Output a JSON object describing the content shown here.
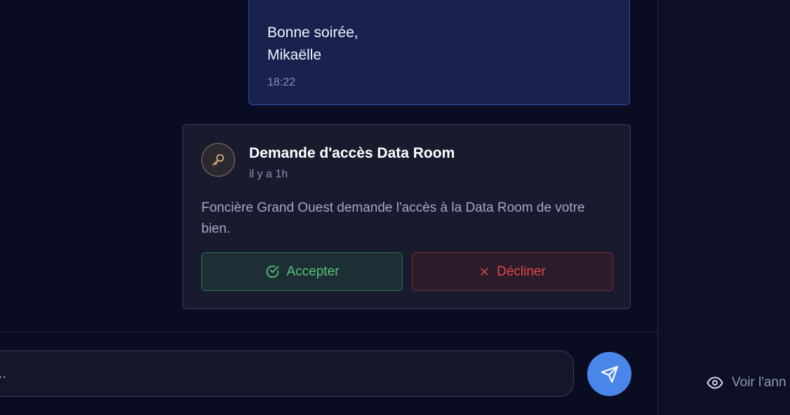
{
  "message": {
    "lines": [
      "Bonne soirée,",
      "Mikaëlle"
    ],
    "time": "18:22"
  },
  "request_card": {
    "icon": "key-icon",
    "title": "Demande d'accès Data Room",
    "time_ago": "il y a 1h",
    "body": "Foncière Grand Ouest demande l'accès à la Data Room de votre bien.",
    "accept_label": "Accepter",
    "decline_label": "Décliner"
  },
  "composer": {
    "placeholder": "e...",
    "send_icon": "send-icon"
  },
  "side_panel": {
    "view_link_label": "Voir l'ann",
    "view_icon": "eye-icon"
  },
  "colors": {
    "accent": "#4a86ea",
    "accept": "#56c47c",
    "decline": "#e04848",
    "bubble": "#19224f"
  }
}
